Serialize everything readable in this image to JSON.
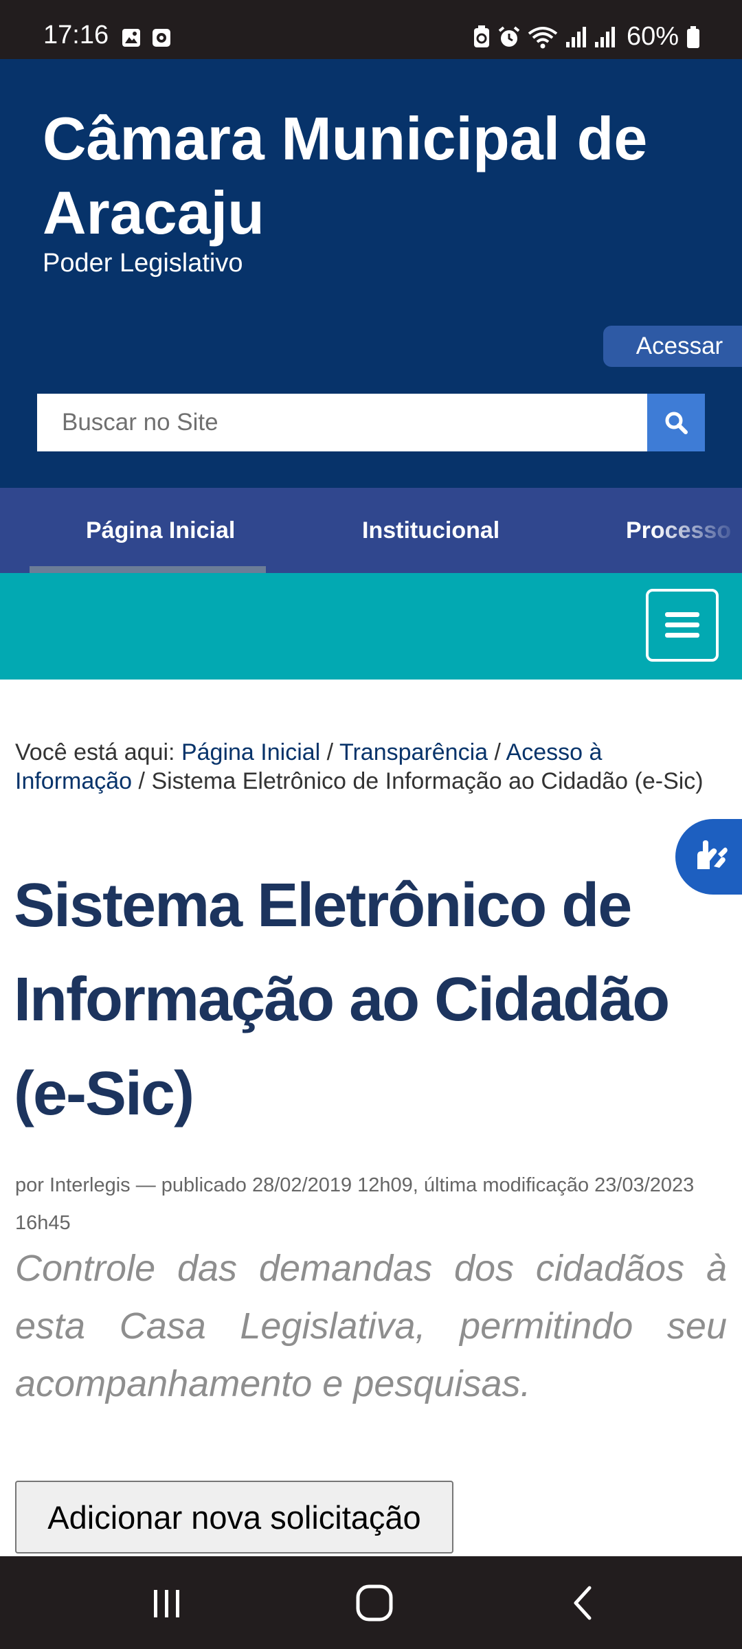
{
  "status_bar": {
    "time": "17:16",
    "battery": "60%",
    "icons": [
      "gallery-icon",
      "screen-record-icon",
      "battery-saver-icon",
      "alarm-icon",
      "wifi-icon",
      "signal-icon",
      "signal-icon",
      "battery-icon"
    ]
  },
  "header": {
    "title": "Câmara Municipal de Aracaju",
    "subtitle": "Poder Legislativo",
    "login_label": "Acessar",
    "search_placeholder": "Buscar no Site",
    "background_color": "#07336a"
  },
  "nav": {
    "tabs": [
      {
        "label": "Página Inicial",
        "active": true
      },
      {
        "label": "Institucional",
        "active": false
      },
      {
        "label": "Processo",
        "active": false
      }
    ],
    "background_color": "#30478e",
    "menu_bar_color": "#02a9b2"
  },
  "breadcrumb": {
    "prefix": "Você está aqui:",
    "items": [
      "Página Inicial",
      "Transparência",
      "Acesso à Informação",
      "Sistema Eletrônico de Informação ao Cidadão (e-Sic)"
    ],
    "separator": "/"
  },
  "page": {
    "title": "Sistema Eletrônico de Informação ao Cidadão (e-Sic)",
    "byline": "por Interlegis — publicado 28/02/2019 12h09, última modificação 23/03/2023 16h45",
    "description": "Controle das demandas dos cidadãos à esta Casa Legislativa, permitindo seu acompanhamento e pesquisas.",
    "add_button_label": "Adicionar nova solicitação"
  },
  "system_nav": [
    "recent-apps-icon",
    "home-icon",
    "back-icon"
  ]
}
